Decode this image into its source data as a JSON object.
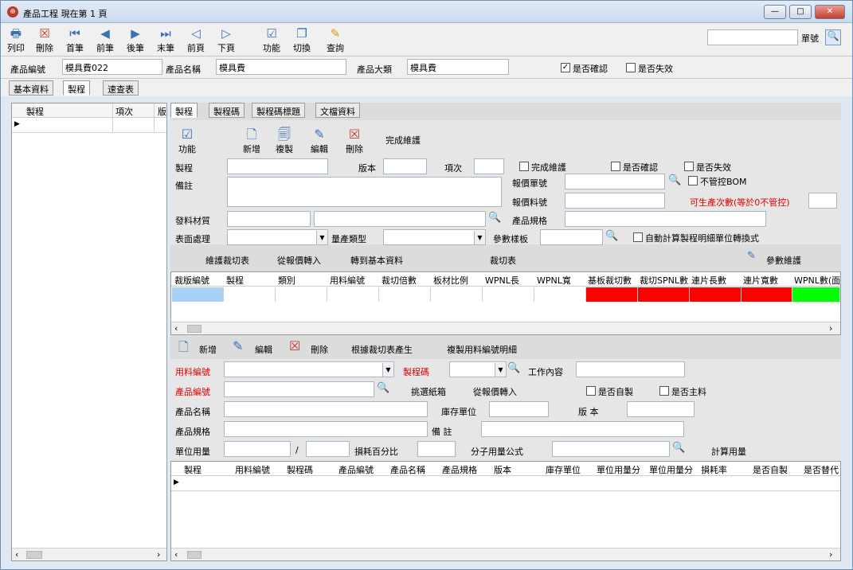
{
  "window": {
    "title": "產品工程  現在第 1 頁",
    "min": "—",
    "max": "□",
    "close": "✕"
  },
  "toolbar": {
    "buttons": [
      {
        "label": "列印",
        "icon": "print-icon"
      },
      {
        "label": "刪除",
        "icon": "delete-icon"
      },
      {
        "label": "首筆",
        "icon": "first-record-icon"
      },
      {
        "label": "前筆",
        "icon": "prev-record-icon"
      },
      {
        "label": "後筆",
        "icon": "next-record-icon"
      },
      {
        "label": "末筆",
        "icon": "last-record-icon"
      },
      {
        "label": "前頁",
        "icon": "prev-page-icon"
      },
      {
        "label": "下頁",
        "icon": "next-page-icon"
      },
      {
        "label": "功能",
        "icon": "function-icon"
      },
      {
        "label": "切換",
        "icon": "switch-icon"
      },
      {
        "label": "查詢",
        "icon": "query-icon"
      }
    ],
    "search_label": "單號",
    "search_value": ""
  },
  "header": {
    "product_no_label": "產品編號",
    "product_no": "模具費022",
    "product_name_label": "產品名稱",
    "product_name": "模具費",
    "category_label": "產品大類",
    "category": "模具費",
    "confirmed_label": "是否確認",
    "confirmed": true,
    "invalid_label": "是否失效",
    "invalid": false
  },
  "tabs": [
    "基本資料",
    "製程",
    "速查表"
  ],
  "active_tab": "製程",
  "left_grid": {
    "columns": [
      "製程",
      "項次",
      "版"
    ]
  },
  "subtabs": [
    "製程",
    "製程碼",
    "製程碼標題",
    "文檔資料"
  ],
  "process_toolbar": {
    "function": "功能",
    "new": "新增",
    "copy": "複製",
    "edit": "編輯",
    "delete": "刪除",
    "done": "完成維護"
  },
  "form": {
    "process": "製程",
    "version": "版本",
    "item": "項次",
    "done_chk": "完成維護",
    "confirm_chk": "是否確認",
    "invalid_chk": "是否失效",
    "note": "備註",
    "quote_no": "報價單號",
    "no_bom": "不管控BOM",
    "quote_part": "報價料號",
    "producible": "可生產次數(等於0不管控)",
    "material": "發料材質",
    "spec": "產品規格",
    "surface": "表面處理",
    "mass_type": "量產類型",
    "param_board": "參數樣板",
    "auto_calc": "自動計算製程明細單位轉換式"
  },
  "cut": {
    "maintain": "維護裁切表",
    "from_quote": "從報價轉入",
    "to_basic": "轉到基本資料",
    "title": "裁切表",
    "param": "參數維護",
    "columns": [
      "裁版編號",
      "製程",
      "類別",
      "用料編號",
      "裁切倍數",
      "板材比例",
      "WPNL長",
      "WPNL寬",
      "基板裁切數",
      "裁切SPNL數",
      "連片長數",
      "連片寬數",
      "WPNL數(面"
    ]
  },
  "detail": {
    "new": "新增",
    "edit": "編輯",
    "delete": "刪除",
    "gen": "根據裁切表產生",
    "copy_part": "複製用料編號明細",
    "part_no": "用料編號",
    "proc_code": "製程碼",
    "work": "工作內容",
    "product_no": "產品編號",
    "pick_box": "挑選紙箱",
    "from_quote": "從報價轉入",
    "self_made": "是否自製",
    "main_mat": "是否主料",
    "product_name": "產品名稱",
    "stock_unit": "庫存單位",
    "version": "版  本",
    "spec": "產品規格",
    "remark": "備    註",
    "unit_use": "單位用量",
    "slash": "/",
    "loss": "損耗百分比",
    "formula": "分子用量公式",
    "calc": "計算用量",
    "columns": [
      "製程",
      "用料編號",
      "製程碼",
      "產品編號",
      "產品名稱",
      "產品規格",
      "版本",
      "庫存單位",
      "單位用量分",
      "單位用量分",
      "損耗率",
      "是否自製",
      "是否替代"
    ]
  },
  "colors": {
    "red": "#ff0000",
    "green": "#00ff00",
    "blue_cell": "#a8d2f5"
  }
}
